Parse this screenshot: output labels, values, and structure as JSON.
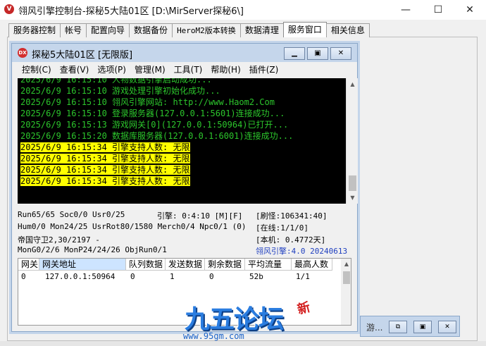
{
  "outer_window": {
    "title": "翎风引擎控制台-探秘5大陆01区 [D:\\MirServer探秘6\\]",
    "icon_glyph": "V",
    "min_glyph": "—",
    "max_glyph": "☐",
    "close_glyph": "✕"
  },
  "tabs": [
    {
      "label": "服务器控制"
    },
    {
      "label": "帐号"
    },
    {
      "label": "配置向导"
    },
    {
      "label": "数据备份"
    },
    {
      "label": "HeroM2版本转换"
    },
    {
      "label": "数据清理"
    },
    {
      "label": "服务窗口"
    },
    {
      "label": "相关信息"
    }
  ],
  "active_tab": "服务窗口",
  "inner_window": {
    "title": "探秘5大陆01区 [无限版]",
    "icon_glyph": "DX",
    "min_glyph": "▁",
    "max_glyph": "▣",
    "close_glyph": "✕",
    "menu": [
      {
        "label": "控制(C)"
      },
      {
        "label": "查看(V)"
      },
      {
        "label": "选项(P)"
      },
      {
        "label": "管理(M)"
      },
      {
        "label": "工具(T)"
      },
      {
        "label": "帮助(H)"
      },
      {
        "label": "插件(Z)"
      }
    ],
    "log_lines": [
      {
        "text": "2025/6/9 16:15:10 人物数据引擎启动成功...",
        "highlight": false
      },
      {
        "text": "2025/6/9 16:15:10 游戏处理引擎初始化成功...",
        "highlight": false
      },
      {
        "text": "2025/6/9 16:15:10 翎风引擎网站: http://www.Haom2.Com",
        "highlight": false
      },
      {
        "text": "2025/6/9 16:15:10 登录服务器(127.0.0.1:5601)连接成功...",
        "highlight": false
      },
      {
        "text": "2025/6/9 16:15:13 游戏网关[0](127.0.0.1:50964)已打开...",
        "highlight": false
      },
      {
        "text": "2025/6/9 16:15:20 数据库服务器(127.0.0.1:6001)连接成功...",
        "highlight": false
      },
      {
        "text": "2025/6/9 16:15:34 引擎支持人数: 无限",
        "highlight": true
      },
      {
        "text": "2025/6/9 16:15:34 引擎支持人数: 无限",
        "highlight": true
      },
      {
        "text": "2025/6/9 16:15:34 引擎支持人数: 无限",
        "highlight": true
      },
      {
        "text": "2025/6/9 16:15:34 引擎支持人数: 无限",
        "highlight": true
      }
    ],
    "status": {
      "run": "Run65/65 Soc0/0 Usr0/25",
      "engine": "引擎: 0:4:10 [M][F]",
      "refresh": "[刷怪:106341:40]",
      "hum": "Hum0/0 Mon24/25 UsrRot80/1580 Merch0/4 Npc0/1 (0)",
      "online": "[在线:1/1/0]",
      "guard": "帝国守卫2,30/2197 -",
      "local": "[本机: 0.4772天]",
      "mongo": "MonG0/2/6 MonP24/24/26 ObjRun0/1",
      "version": "翎风引擎:4.0 20240613"
    },
    "gate_table": {
      "headers": [
        "网关",
        "网关地址",
        "队列数据",
        "发送数据",
        "剩余数据",
        "平均流量",
        "最高人数"
      ],
      "rows": [
        [
          "0",
          "127.0.0.1:50964",
          "0",
          "1",
          "0",
          "52b",
          "1/1"
        ]
      ]
    }
  },
  "minimized_window": {
    "label": "游...",
    "restore_glyph": "⧉",
    "max_glyph": "▣",
    "close_glyph": "✕"
  },
  "watermark": {
    "text": "九五论坛",
    "seal": "新",
    "url": "www.95gm.com"
  },
  "colors": {
    "log_text": "#2cc62c",
    "log_highlight": "#ffff00",
    "version_text": "#1f3fbf",
    "inner_titlebar": "#c5d6eb"
  }
}
